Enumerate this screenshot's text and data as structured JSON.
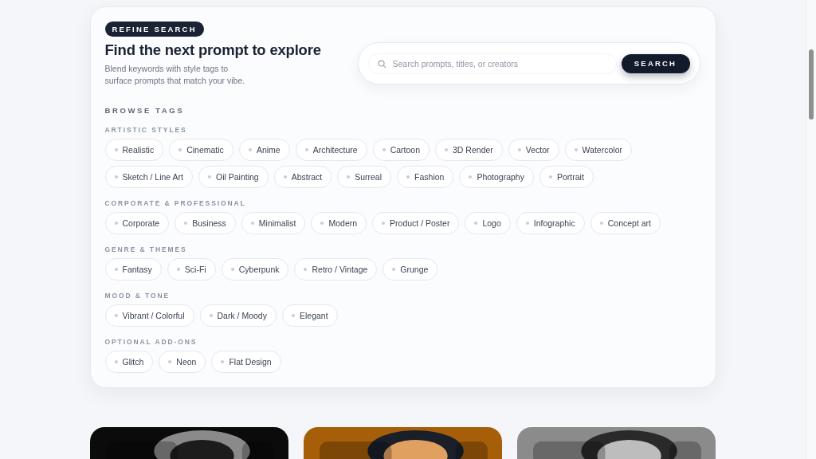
{
  "header": {
    "badge": "REFINE SEARCH",
    "title": "Find the next prompt to explore",
    "subtitle": "Blend keywords with style tags to surface prompts that match your vibe."
  },
  "search": {
    "placeholder": "Search prompts, titles, or creators",
    "button": "SEARCH"
  },
  "browse_title": "BROWSE TAGS",
  "tag_groups": [
    {
      "label": "ARTISTIC STYLES",
      "tags": [
        "Realistic",
        "Cinematic",
        "Anime",
        "Architecture",
        "Cartoon",
        "3D Render",
        "Vector",
        "Watercolor",
        "Sketch / Line Art",
        "Oil Painting",
        "Abstract",
        "Surreal",
        "Fashion",
        "Photography",
        "Portrait"
      ]
    },
    {
      "label": "CORPORATE & PROFESSIONAL",
      "tags": [
        "Corporate",
        "Business",
        "Minimalist",
        "Modern",
        "Product / Poster",
        "Logo",
        "Infographic",
        "Concept art"
      ]
    },
    {
      "label": "GENRE & THEMES",
      "tags": [
        "Fantasy",
        "Sci-Fi",
        "Cyberpunk",
        "Retro / Vintage",
        "Grunge"
      ]
    },
    {
      "label": "MOOD & TONE",
      "tags": [
        "Vibrant / Colorful",
        "Dark / Moody",
        "Elegant"
      ]
    },
    {
      "label": "OPTIONAL ADD-ONS",
      "tags": [
        "Glitch",
        "Neon",
        "Flat Design"
      ]
    }
  ]
}
